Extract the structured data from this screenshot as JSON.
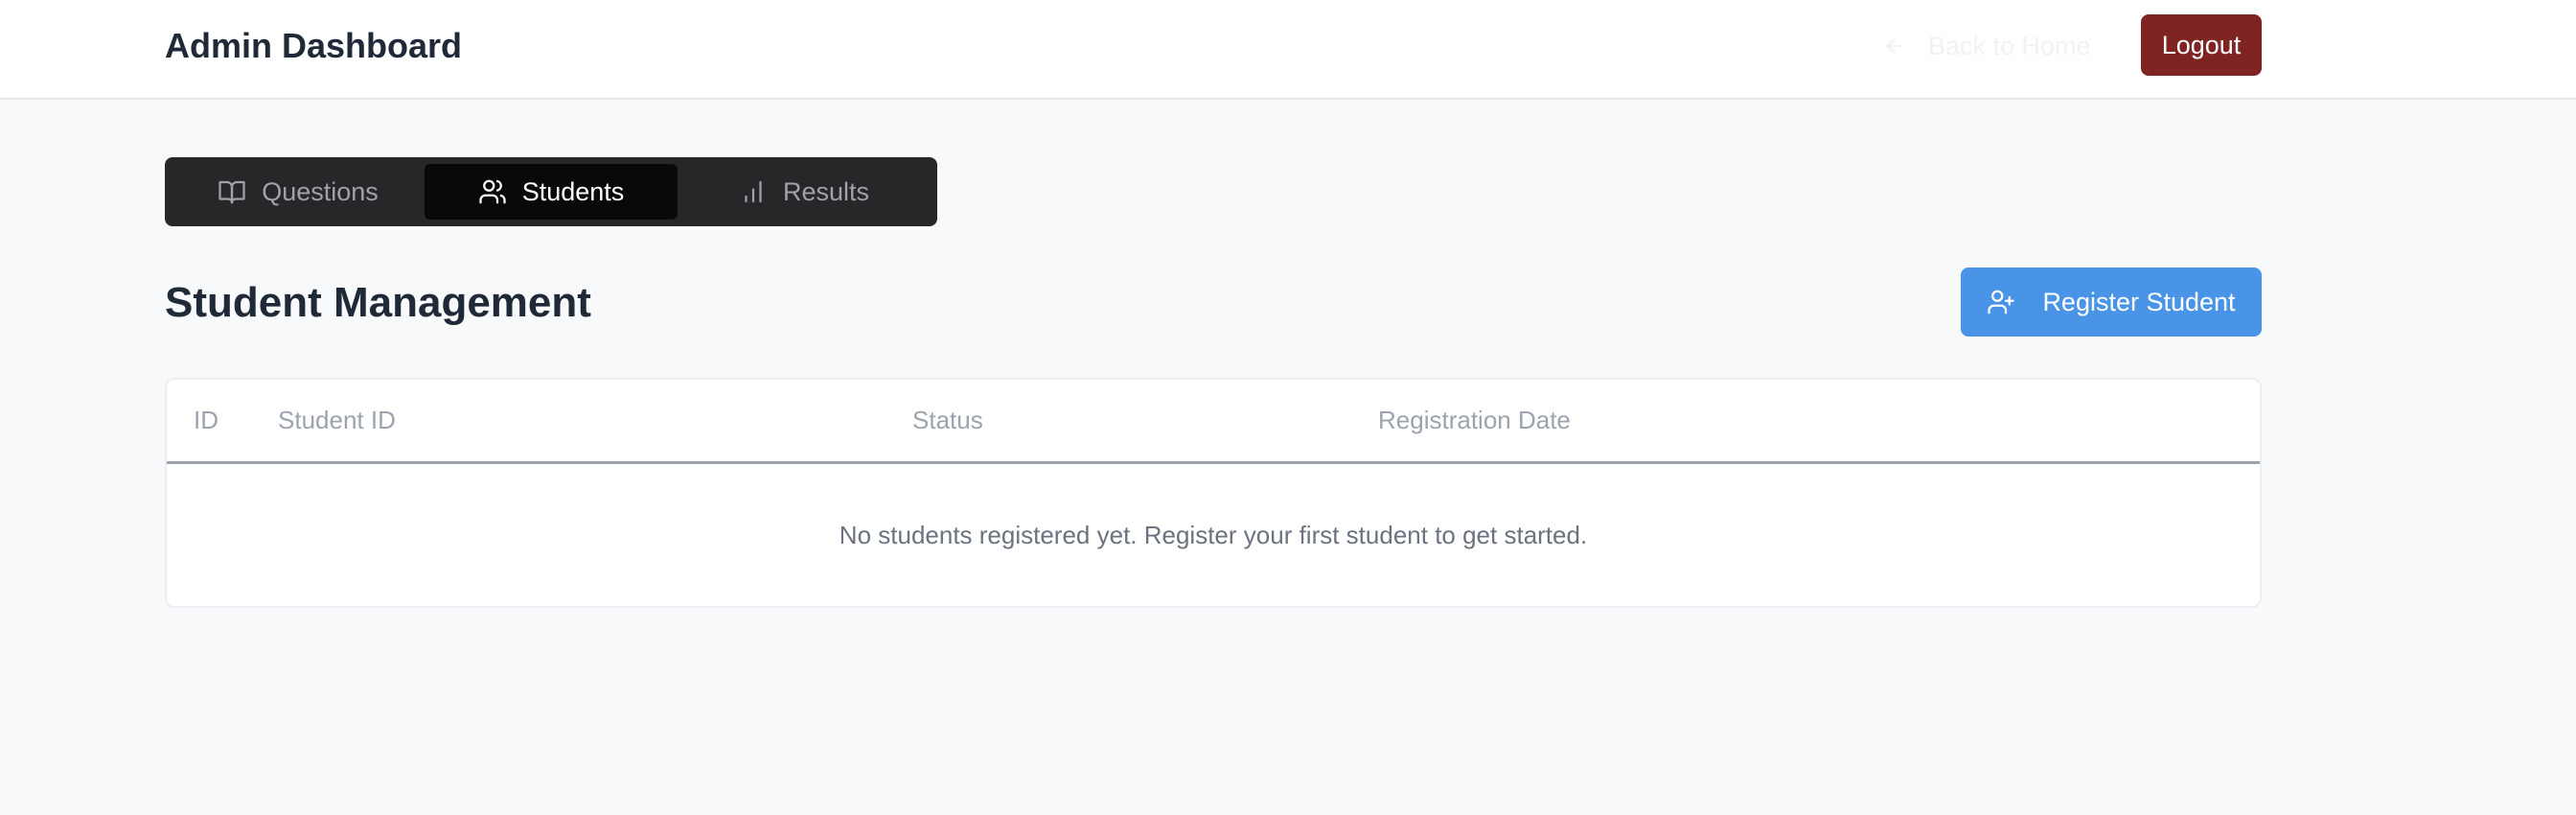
{
  "header": {
    "title": "Admin Dashboard",
    "back_label": "Back to Home",
    "logout_label": "Logout"
  },
  "tabs": [
    {
      "label": "Questions",
      "icon": "book-open-icon",
      "active": false
    },
    {
      "label": "Students",
      "icon": "users-icon",
      "active": true
    },
    {
      "label": "Results",
      "icon": "bar-chart-icon",
      "active": false
    }
  ],
  "main": {
    "heading": "Student Management",
    "register_label": "Register Student"
  },
  "table": {
    "columns": [
      "ID",
      "Student ID",
      "Status",
      "Registration Date"
    ],
    "rows": [],
    "empty_message": "No students registered yet. Register your first student to get started."
  },
  "colors": {
    "logout": "#7f2323",
    "primary": "#4a94e8",
    "tabs_bg": "#27272a",
    "tab_active": "#09090b"
  }
}
